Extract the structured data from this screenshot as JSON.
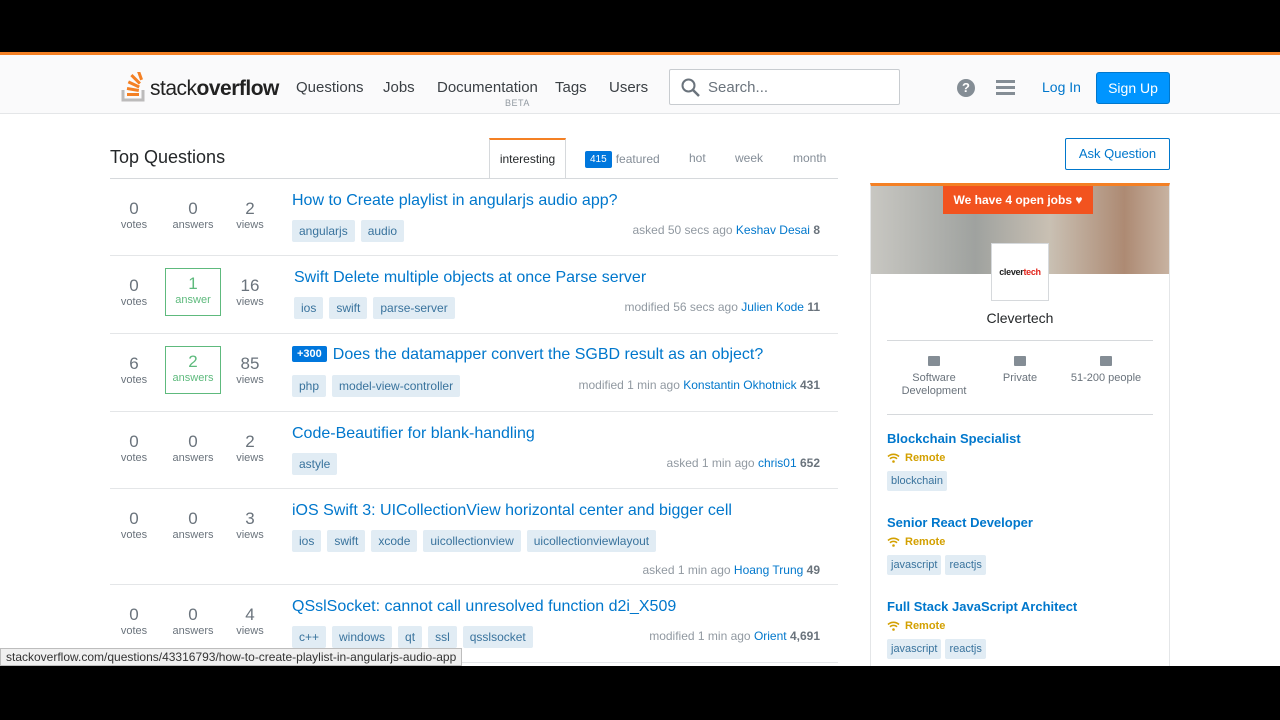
{
  "header": {
    "logo_prefix": "stack",
    "logo_bold": "overflow",
    "nav": [
      "Questions",
      "Jobs",
      "Documentation",
      "Tags",
      "Users"
    ],
    "nav_beta": "BETA",
    "search_placeholder": "Search...",
    "help": "?",
    "login": "Log In",
    "signup": "Sign Up"
  },
  "main": {
    "title": "Top Questions",
    "tabs": [
      "interesting",
      "featured",
      "hot",
      "week",
      "month"
    ],
    "featured_count": "415",
    "questions": [
      {
        "votes": "0",
        "votes_label": "votes",
        "answers": "0",
        "answers_label": "answers",
        "views": "2",
        "views_label": "views",
        "title": "How to Create playlist in angularjs audio app?",
        "tags": [
          "angularjs",
          "audio"
        ],
        "action": "asked 50 secs ago",
        "user": "Keshav Desai",
        "rep": "8"
      },
      {
        "votes": "0",
        "votes_label": "votes",
        "answers": "1",
        "answers_label": "answer",
        "views": "16",
        "views_label": "views",
        "title": "Swift Delete multiple objects at once Parse server",
        "tags": [
          "ios",
          "swift",
          "parse-server"
        ],
        "action": "modified 56 secs ago",
        "user": "Julien Kode",
        "rep": "11"
      },
      {
        "votes": "6",
        "votes_label": "votes",
        "answers": "2",
        "answers_label": "answers",
        "views": "85",
        "views_label": "views",
        "bounty": "+300",
        "title": "Does the datamapper convert the SGBD result as an object?",
        "tags": [
          "php",
          "model-view-controller"
        ],
        "action": "modified 1 min ago",
        "user": "Konstantin Okhotnick",
        "rep": "431"
      },
      {
        "votes": "0",
        "votes_label": "votes",
        "answers": "0",
        "answers_label": "answers",
        "views": "2",
        "views_label": "views",
        "title": "Code-Beautifier for blank-handling",
        "tags": [
          "astyle"
        ],
        "action": "asked 1 min ago",
        "user": "chris01",
        "rep": "652"
      },
      {
        "votes": "0",
        "votes_label": "votes",
        "answers": "0",
        "answers_label": "answers",
        "views": "3",
        "views_label": "views",
        "title": "iOS Swift 3: UICollectionView horizontal center and bigger cell",
        "tags": [
          "ios",
          "swift",
          "xcode",
          "uicollectionview",
          "uicollectionviewlayout"
        ],
        "action": "asked 1 min ago",
        "user": "Hoang Trung",
        "rep": "49"
      },
      {
        "votes": "0",
        "votes_label": "votes",
        "answers": "0",
        "answers_label": "answers",
        "views": "4",
        "views_label": "views",
        "title": "QSslSocket: cannot call unresolved function d2i_X509",
        "tags": [
          "c++",
          "windows",
          "qt",
          "ssl",
          "qsslsocket"
        ],
        "action": "modified 1 min ago",
        "user": "Orient",
        "rep": "4,691"
      }
    ]
  },
  "sidebar": {
    "ask": "Ask Question",
    "open_jobs": "We have 4 open jobs ♥",
    "company_logo_a": "clever",
    "company_logo_b": "tech",
    "company": "Clevertech",
    "facts": [
      "Software Development",
      "Private",
      "51-200 people"
    ],
    "jobs": [
      {
        "title": "Blockchain Specialist",
        "remote": "Remote",
        "tags": [
          "blockchain"
        ]
      },
      {
        "title": "Senior React Developer",
        "remote": "Remote",
        "tags": [
          "javascript",
          "reactjs"
        ]
      },
      {
        "title": "Full Stack JavaScript Architect",
        "remote": "Remote",
        "tags": [
          "javascript",
          "reactjs"
        ]
      }
    ]
  },
  "status_url": "stackoverflow.com/questions/43316793/how-to-create-playlist-in-angularjs-audio-app",
  "colors": {
    "accent": "#f48024",
    "link": "#0077cc",
    "answered": "#5eba7d",
    "tag_bg": "#e1ecf4"
  }
}
